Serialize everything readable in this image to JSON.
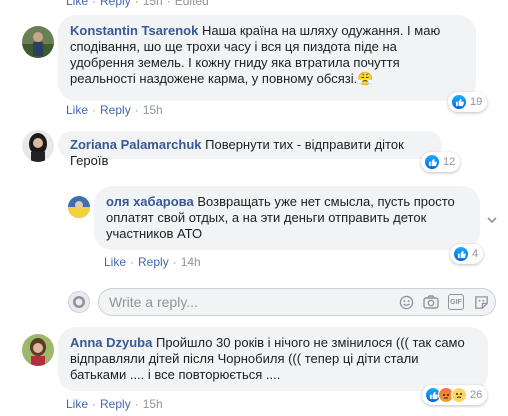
{
  "top_actions": {
    "like": "Like",
    "reply": "Reply",
    "time": "15h",
    "edited": "Edited"
  },
  "comments": [
    {
      "author": "Konstantin Tsarenok",
      "text": "Наша країна на шляху одужання. І маю сподівання, шо ще трохи часу і вся ця пиздота піде на удобрення земель. І кожну гниду яка втратила почуття реальності наздожене карма, у повному обсязі.",
      "emoji": "😤",
      "like": "Like",
      "reply": "Reply",
      "time": "15h",
      "reactions": "19"
    },
    {
      "author": "Zoriana Palamarchuk",
      "text": "Повернути тих - відправити діток Героїв",
      "reactions": "12"
    },
    {
      "author": "оля хабарова",
      "text": "Возвращать уже нет смысла, пусть просто оплатят свой отдых, а на эти деньги отправить деток участников АТО",
      "like": "Like",
      "reply": "Reply",
      "time": "14h",
      "reactions": "4"
    },
    {
      "author": "Anna Dzyuba",
      "text": "Пройшло 30 років і нічого не змінилося ((( так само відправляли дітей після Чорнобиля ((( тепер ці діти стали батьками .... і все повторюється ....",
      "like": "Like",
      "reply": "Reply",
      "time": "15h",
      "reactions": "26"
    }
  ],
  "reply_box": {
    "placeholder": "Write a reply..."
  },
  "icons": [
    "emoji-icon",
    "camera-icon",
    "gif-icon",
    "sticker-icon",
    "like-reaction-icon",
    "angry-reaction-icon",
    "sad-reaction-icon",
    "options-chevron-icon"
  ],
  "colors": {
    "link": "#4267b2",
    "author": "#385898",
    "bubble": "#f2f3f5",
    "meta": "#90949c"
  }
}
